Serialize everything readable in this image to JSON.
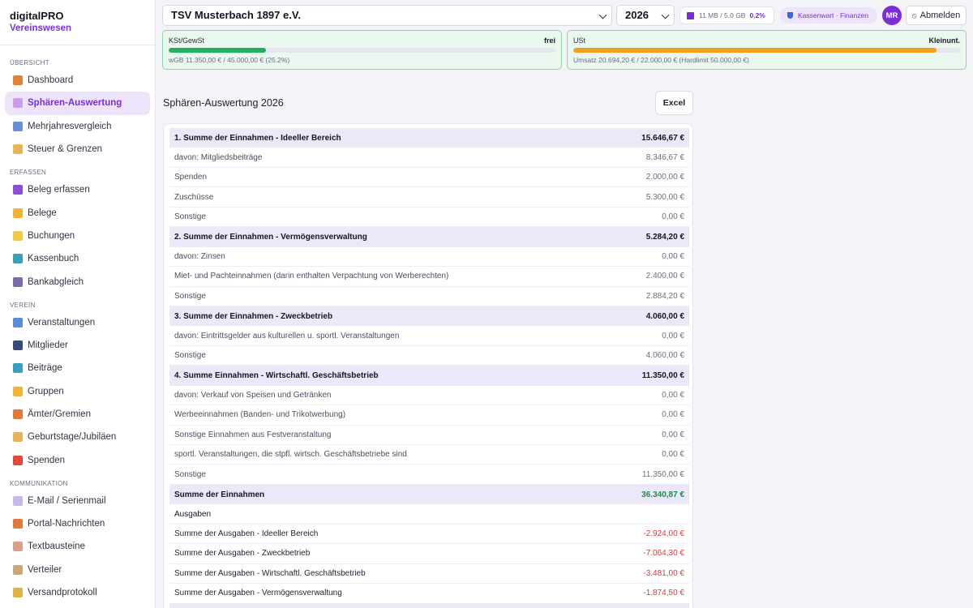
{
  "brand": {
    "title": "digitalPRO",
    "subtitle": "Vereinswesen"
  },
  "sidebar": {
    "sections": [
      {
        "label": "ÜBERSICHT",
        "items": [
          {
            "label": "Dashboard",
            "icon": "chart-icon",
            "color": "#e0823a"
          },
          {
            "label": "Sphären-Auswertung",
            "icon": "document-icon",
            "color": "#c9a0e8",
            "active": true
          },
          {
            "label": "Mehrjahresvergleich",
            "icon": "trend-icon",
            "color": "#6a8fd8"
          },
          {
            "label": "Steuer & Grenzen",
            "icon": "balance-icon",
            "color": "#e8b45a"
          }
        ]
      },
      {
        "label": "ERFASSEN",
        "items": [
          {
            "label": "Beleg erfassen",
            "icon": "plus-icon",
            "color": "#8a4fd6"
          },
          {
            "label": "Belege",
            "icon": "folder-icon",
            "color": "#f0b43a"
          },
          {
            "label": "Buchungen",
            "icon": "ledger-icon",
            "color": "#f0c84a"
          },
          {
            "label": "Kassenbuch",
            "icon": "cash-icon",
            "color": "#3aa0b8"
          },
          {
            "label": "Bankabgleich",
            "icon": "bank-icon",
            "color": "#7a6aa8"
          }
        ]
      },
      {
        "label": "VEREIN",
        "items": [
          {
            "label": "Veranstaltungen",
            "icon": "event-icon",
            "color": "#5a8ad8"
          },
          {
            "label": "Mitglieder",
            "icon": "members-icon",
            "color": "#3a4a7a"
          },
          {
            "label": "Beiträge",
            "icon": "fees-icon",
            "color": "#3aa0b8"
          },
          {
            "label": "Gruppen",
            "icon": "tag-icon",
            "color": "#f0b43a"
          },
          {
            "label": "Ämter/Gremien",
            "icon": "medal-icon",
            "color": "#e07a3a"
          },
          {
            "label": "Geburtstage/Jubiläen",
            "icon": "cake-icon",
            "color": "#e8b45a"
          },
          {
            "label": "Spenden",
            "icon": "gift-icon",
            "color": "#e04a3a"
          }
        ]
      },
      {
        "label": "KOMMUNIKATION",
        "items": [
          {
            "label": "E-Mail / Serienmail",
            "icon": "mail-icon",
            "color": "#c9b8e8"
          },
          {
            "label": "Portal-Nachrichten",
            "icon": "megaphone-icon",
            "color": "#e07a3a"
          },
          {
            "label": "Textbausteine",
            "icon": "note-icon",
            "color": "#d8a08a"
          },
          {
            "label": "Verteiler",
            "icon": "clipboard-icon",
            "color": "#c8a878"
          },
          {
            "label": "Versandprotokoll",
            "icon": "scroll-icon",
            "color": "#e0b04a"
          }
        ]
      }
    ]
  },
  "topbar": {
    "club": "TSV Musterbach 1897 e.V.",
    "year": "2026",
    "storage_text": "11 MB / 5.0 GB",
    "storage_pct": "0.2%",
    "role": "Kassenwart · Finanzen",
    "avatar": "MR",
    "logout": "Abmelden"
  },
  "limits": [
    {
      "label": "KSt/GewSt",
      "status": "frei",
      "fill": 0.252,
      "color": "#22b060",
      "sub": "wGB 11.350,00 € / 45.000,00 € (25.2%)"
    },
    {
      "label": "USt",
      "status": "Kleinunt.",
      "fill": 0.94,
      "color": "#f0a020",
      "sub": "Umsatz 20.694,20 € / 22.000,00 € (Hardlimit 50.000,00 €)"
    }
  ],
  "page": {
    "title": "Sphären-Auswertung 2026",
    "excel_label": "Excel"
  },
  "rows": [
    {
      "type": "head",
      "label": "1. Summe der Einnahmen - Ideeller Bereich",
      "amount": "15.646,67 €"
    },
    {
      "type": "item",
      "label": "davon: Mitgliedsbeiträge",
      "amount": "8.346,67 €"
    },
    {
      "type": "item",
      "label": "Spenden",
      "amount": "2.000,00 €"
    },
    {
      "type": "item",
      "label": "Zuschüsse",
      "amount": "5.300,00 €"
    },
    {
      "type": "item",
      "label": "Sonstige",
      "amount": "0,00 €"
    },
    {
      "type": "head",
      "label": "2. Summe der Einnahmen - Vermögensverwaltung",
      "amount": "5.284,20 €"
    },
    {
      "type": "item",
      "label": "davon: Zinsen",
      "amount": "0,00 €"
    },
    {
      "type": "item",
      "label": "Miet- und Pachteinnahmen (darin enthalten Verpachtung von Werberechten)",
      "amount": "2.400,00 €"
    },
    {
      "type": "item",
      "label": "Sonstige",
      "amount": "2.884,20 €"
    },
    {
      "type": "head",
      "label": "3. Summe der Einnahmen - Zweckbetrieb",
      "amount": "4.060,00 €"
    },
    {
      "type": "item",
      "label": "davon: Eintrittsgelder aus kulturellen u. sportl. Veranstaltungen",
      "amount": "0,00 €"
    },
    {
      "type": "item",
      "label": "Sonstige",
      "amount": "4.060,00 €"
    },
    {
      "type": "head",
      "label": "4. Summe Einnahmen - Wirtschaftl. Geschäftsbetrieb",
      "amount": "11.350,00 €"
    },
    {
      "type": "item",
      "label": "davon: Verkauf von Speisen und Getränken",
      "amount": "0,00 €"
    },
    {
      "type": "item",
      "label": "Werbeeinnahmen (Banden- und Trikotwerbung)",
      "amount": "0,00 €"
    },
    {
      "type": "item",
      "label": "Sonstige Einnahmen aus Festveranstaltung",
      "amount": "0,00 €"
    },
    {
      "type": "item",
      "label": "sportl. Veranstaltungen, die stpfl. wirtsch. Geschäftsbetriebe sind",
      "amount": "0,00 €"
    },
    {
      "type": "item",
      "label": "Sonstige",
      "amount": "11.350,00 €"
    },
    {
      "type": "total",
      "label": "Summe der Einnahmen",
      "amount": "36.340,87 €",
      "tone": "pos"
    },
    {
      "type": "section",
      "label": "Ausgaben",
      "amount": ""
    },
    {
      "type": "exp",
      "label": "Summe der Ausgaben - Ideeller Bereich",
      "amount": "-2.924,00 €",
      "tone": "neg"
    },
    {
      "type": "exp",
      "label": "Summe der Ausgaben - Zweckbetrieb",
      "amount": "-7.064,30 €",
      "tone": "neg"
    },
    {
      "type": "exp",
      "label": "Summe der Ausgaben - Wirtschaftl. Geschäftsbetrieb",
      "amount": "-3.481,00 €",
      "tone": "neg"
    },
    {
      "type": "exp",
      "label": "Summe der Ausgaben - Vermögensverwaltung",
      "amount": "-1.874,50 €",
      "tone": "neg"
    },
    {
      "type": "total",
      "label": "",
      "amount": ""
    }
  ]
}
